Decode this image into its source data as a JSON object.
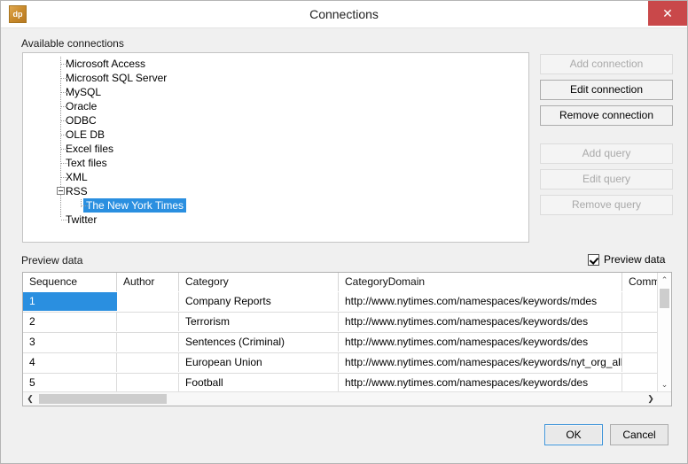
{
  "window": {
    "title": "Connections",
    "app_icon_text": "dp",
    "close_label": "✕"
  },
  "available_connections": {
    "label": "Available connections",
    "nodes": [
      {
        "label": "Microsoft Access",
        "level": 0,
        "selected": false
      },
      {
        "label": "Microsoft SQL Server",
        "level": 0,
        "selected": false
      },
      {
        "label": "MySQL",
        "level": 0,
        "selected": false
      },
      {
        "label": "Oracle",
        "level": 0,
        "selected": false
      },
      {
        "label": "ODBC",
        "level": 0,
        "selected": false
      },
      {
        "label": "OLE DB",
        "level": 0,
        "selected": false
      },
      {
        "label": "Excel files",
        "level": 0,
        "selected": false
      },
      {
        "label": "Text files",
        "level": 0,
        "selected": false
      },
      {
        "label": "XML",
        "level": 0,
        "selected": false
      },
      {
        "label": "RSS",
        "level": 0,
        "selected": false,
        "expander": "minus"
      },
      {
        "label": "The New York Times",
        "level": 1,
        "selected": true
      },
      {
        "label": "Twitter",
        "level": 0,
        "selected": false
      }
    ]
  },
  "side_buttons": [
    {
      "label": "Add connection",
      "enabled": false
    },
    {
      "label": "Edit connection",
      "enabled": true
    },
    {
      "label": "Remove connection",
      "enabled": true
    },
    {
      "label": "Add query",
      "enabled": false
    },
    {
      "label": "Edit query",
      "enabled": false
    },
    {
      "label": "Remove query",
      "enabled": false
    }
  ],
  "preview": {
    "section_label": "Preview data",
    "checkbox_label": "Preview data",
    "checkbox_checked": true,
    "columns": [
      "Sequence",
      "Author",
      "Category",
      "CategoryDomain",
      "Comments"
    ],
    "rows": [
      {
        "Sequence": "1",
        "Author": "",
        "Category": "Company Reports",
        "CategoryDomain": "http://www.nytimes.com/namespaces/keywords/mdes",
        "Comments": "",
        "selected_cell": "Sequence"
      },
      {
        "Sequence": "2",
        "Author": "",
        "Category": "Terrorism",
        "CategoryDomain": "http://www.nytimes.com/namespaces/keywords/des",
        "Comments": ""
      },
      {
        "Sequence": "3",
        "Author": "",
        "Category": "Sentences (Criminal)",
        "CategoryDomain": "http://www.nytimes.com/namespaces/keywords/des",
        "Comments": ""
      },
      {
        "Sequence": "4",
        "Author": "",
        "Category": "European Union",
        "CategoryDomain": "http://www.nytimes.com/namespaces/keywords/nyt_org_all",
        "Comments": ""
      },
      {
        "Sequence": "5",
        "Author": "",
        "Category": "Football",
        "CategoryDomain": "http://www.nytimes.com/namespaces/keywords/des",
        "Comments": ""
      }
    ],
    "scroll": {
      "v_up_glyph": "⌃",
      "v_down_glyph": "⌄",
      "h_left_glyph": "❮",
      "h_right_glyph": "❯"
    }
  },
  "footer": {
    "ok_label": "OK",
    "cancel_label": "Cancel"
  },
  "colors": {
    "selection_blue": "#2a8fe0",
    "close_red": "#c9484a",
    "dialog_background": "#f0f0f0",
    "focus_border": "#3c93d8"
  }
}
